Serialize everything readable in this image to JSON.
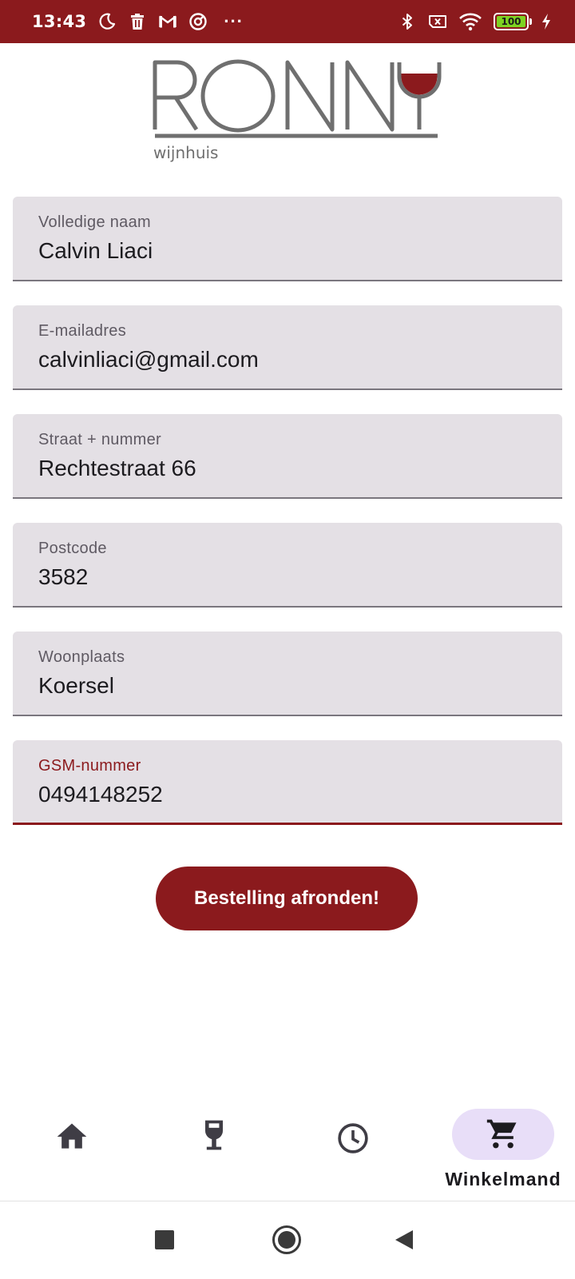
{
  "status_bar": {
    "time": "13:43",
    "battery_level": "100",
    "icons": [
      "moon-icon",
      "trash-icon",
      "gmail-icon",
      "circle-icon",
      "more-icon",
      "bluetooth-icon",
      "sim-off-icon",
      "wifi-icon",
      "battery-icon",
      "charging-icon"
    ]
  },
  "logo": {
    "wordmark": "RONNY",
    "subtitle": "wijnhuis"
  },
  "form": {
    "fields": [
      {
        "label": "Volledige naam",
        "value": "Calvin Liaci"
      },
      {
        "label": "E-mailadres",
        "value": "calvinliaci@gmail.com"
      },
      {
        "label": "Straat + nummer",
        "value": "Rechtestraat 66"
      },
      {
        "label": "Postcode",
        "value": "3582"
      },
      {
        "label": "Woonplaats",
        "value": "Koersel"
      },
      {
        "label": "GSM-nummer",
        "value": "0494148252"
      }
    ],
    "submit_label": "Bestelling afronden!"
  },
  "bottom_nav": {
    "items": [
      {
        "icon": "home-icon",
        "label": ""
      },
      {
        "icon": "wine-glass-icon",
        "label": ""
      },
      {
        "icon": "history-clock-icon",
        "label": ""
      },
      {
        "icon": "cart-icon",
        "label": "Winkelmand",
        "selected": true
      }
    ]
  },
  "system_nav": {
    "buttons": [
      "recents",
      "home",
      "back"
    ]
  },
  "colors": {
    "brand": "#8b1a1d",
    "field_bg": "#e4e0e5",
    "nav_indicator": "#e8def8",
    "battery_fill": "#7ed321"
  }
}
